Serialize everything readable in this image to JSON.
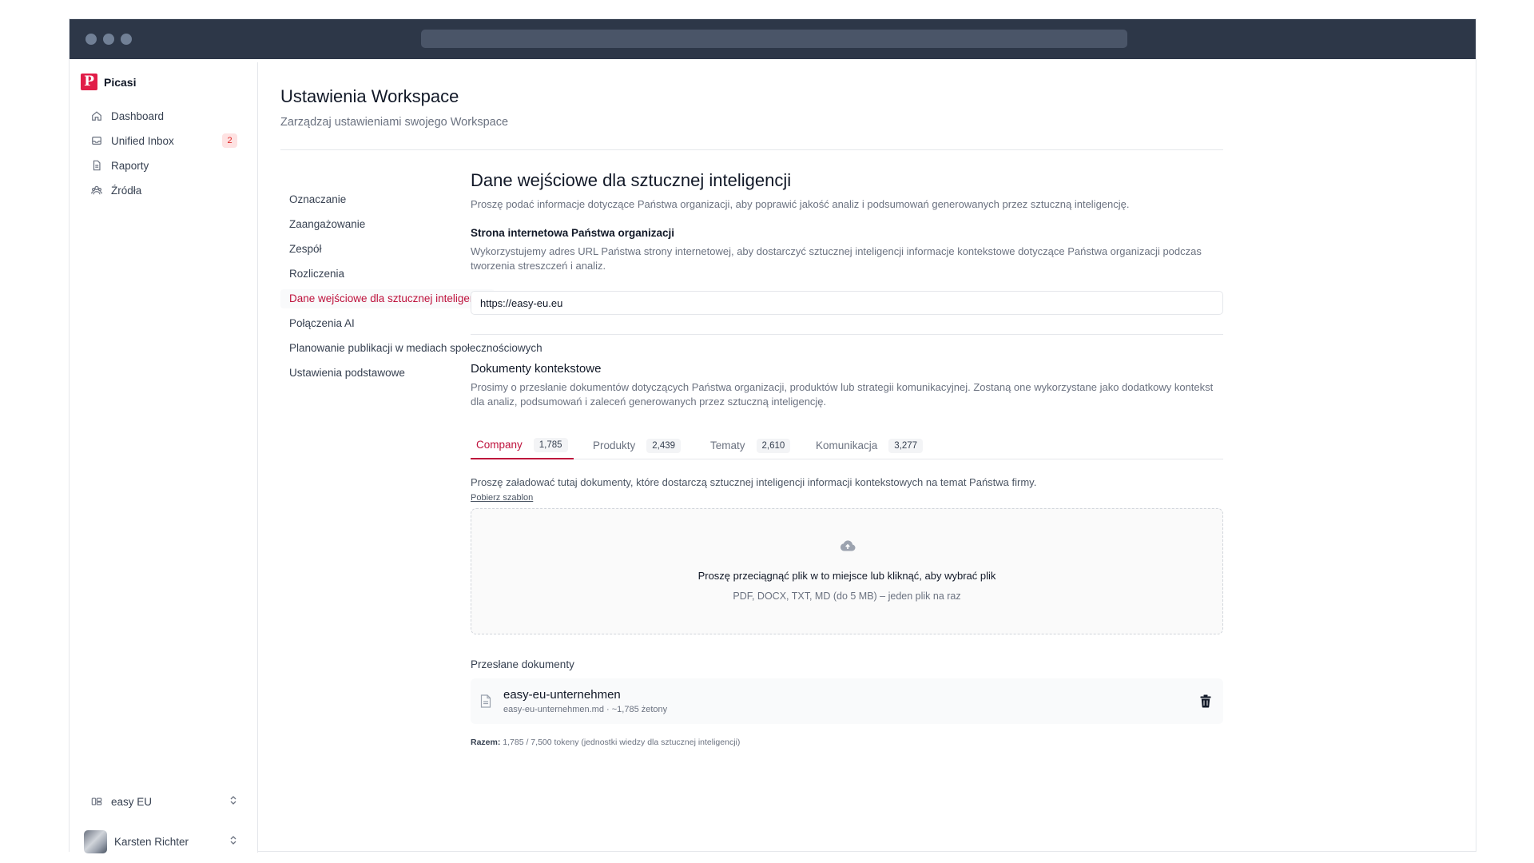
{
  "sidebar": {
    "brand": {
      "logo_letter": "P",
      "name": "Picasi"
    },
    "items": [
      {
        "label": "Dashboard",
        "icon": "home-icon"
      },
      {
        "label": "Unified Inbox",
        "icon": "inbox-icon",
        "badge": "2"
      },
      {
        "label": "Raporty",
        "icon": "document-icon"
      },
      {
        "label": "Źródła",
        "icon": "sources-icon"
      }
    ],
    "workspace": "easy EU",
    "user": "Karsten Richter"
  },
  "header": {
    "title": "Ustawienia Workspace",
    "subtitle": "Zarządzaj ustawieniami swojego Workspace"
  },
  "settings_nav": [
    {
      "label": "Oznaczanie",
      "active": false
    },
    {
      "label": "Zaangażowanie",
      "active": false
    },
    {
      "label": "Zespół",
      "active": false
    },
    {
      "label": "Rozliczenia",
      "active": false
    },
    {
      "label": "Dane wejściowe dla sztucznej inteligencji",
      "active": true
    },
    {
      "label": "Połączenia AI",
      "active": false
    },
    {
      "label": "Planowanie publikacji w mediach społecznościowych",
      "active": false
    },
    {
      "label": "Ustawienia podstawowe",
      "active": false
    }
  ],
  "content": {
    "title": "Dane wejściowe dla sztucznej inteligencji",
    "description": "Proszę podać informacje dotyczące Państwa organizacji, aby poprawić jakość analiz i podsumowań generowanych przez sztuczną inteligencję.",
    "website": {
      "heading": "Strona internetowa Państwa organizacji",
      "description": "Wykorzystujemy adres URL Państwa strony internetowej, aby dostarczyć sztucznej inteligencji informacje kontekstowe dotyczące Państwa organizacji podczas tworzenia streszczeń i analiz.",
      "value": "https://easy-eu.eu"
    },
    "documents": {
      "heading": "Dokumenty kontekstowe",
      "description": "Prosimy o przesłanie dokumentów dotyczących Państwa organizacji, produktów lub strategii komunikacyjnej. Zostaną one wykorzystane jako dodatkowy kontekst dla analiz, podsumowań i zaleceń generowanych przez sztuczną inteligencję.",
      "tabs": [
        {
          "label": "Company",
          "count": "1,785",
          "active": true
        },
        {
          "label": "Produkty",
          "count": "2,439",
          "active": false
        },
        {
          "label": "Tematy",
          "count": "2,610",
          "active": false
        },
        {
          "label": "Komunikacja",
          "count": "3,277",
          "active": false
        }
      ],
      "tab_hint": "Proszę załadować tutaj dokumenty, które dostarczą sztucznej inteligencji informacji kontekstowych na temat Państwa firmy.",
      "template_link": "Pobierz szablon",
      "dropzone": {
        "icon": "cloud-upload-icon",
        "main": "Proszę przeciągnąć plik w to miejsce lub kliknąć, aby wybrać plik",
        "sub": "PDF, DOCX, TXT, MD (do 5 MB) – jeden plik na raz"
      },
      "uploaded_heading": "Przesłane dokumenty",
      "files": [
        {
          "name": "easy-eu-unternehmen",
          "meta": "easy-eu-unternehmen.md · ~1,785 żetony"
        }
      ],
      "total_label": "Razem:",
      "total_value": "1,785 / 7,500 tokeny (jednostki wiedzy dla sztucznej inteligencji)"
    }
  },
  "colors": {
    "accent": "#be123c",
    "brand": "#e11d48",
    "titlebar": "#2d3748",
    "badge_bg": "#fee2e2",
    "badge_text": "#dc2626"
  }
}
